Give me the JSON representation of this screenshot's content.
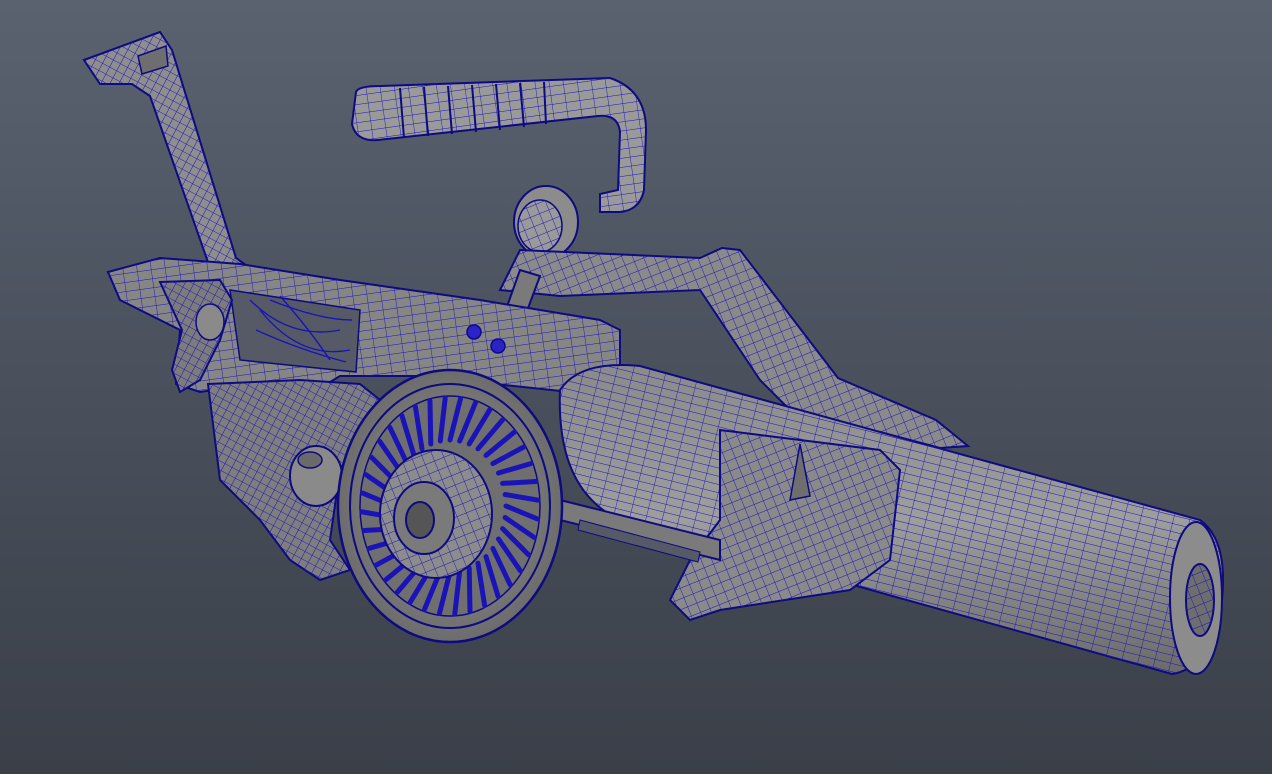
{
  "viewport": {
    "background_top": "#5a6270",
    "background_bottom": "#3a3f48",
    "mesh_fill": "#8c8c8c",
    "mesh_fill_light": "#9c9c9c",
    "mesh_fill_dark": "#6e6e6e",
    "wire_color": "#1a14b8",
    "edge_color": "#0e0a80"
  },
  "object": {
    "name": "",
    "parts": [
      "stock",
      "top-handle",
      "receiver",
      "fan-wheel",
      "barrel",
      "upper-guard",
      "lower-rail",
      "side-plate"
    ]
  }
}
